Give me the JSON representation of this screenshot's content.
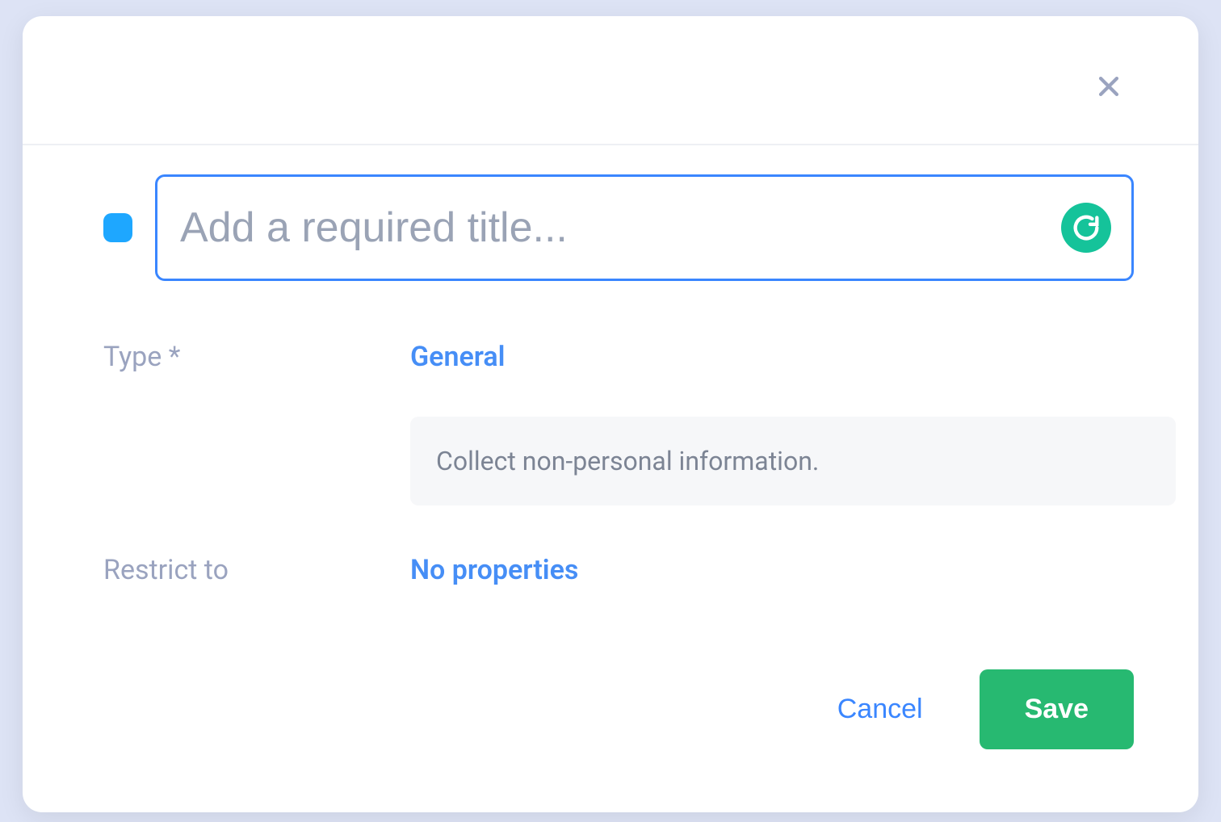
{
  "colors": {
    "accent": "#1ea7ff",
    "primary_blue": "#3a86ff",
    "save_green": "#27b971",
    "grammarly_green": "#15c39a"
  },
  "title": {
    "value": "",
    "placeholder": "Add a required title..."
  },
  "fields": {
    "type": {
      "label": "Type *",
      "value": "General",
      "description": "Collect non-personal information."
    },
    "restrict": {
      "label": "Restrict to",
      "value": "No properties"
    }
  },
  "footer": {
    "cancel": "Cancel",
    "save": "Save"
  }
}
